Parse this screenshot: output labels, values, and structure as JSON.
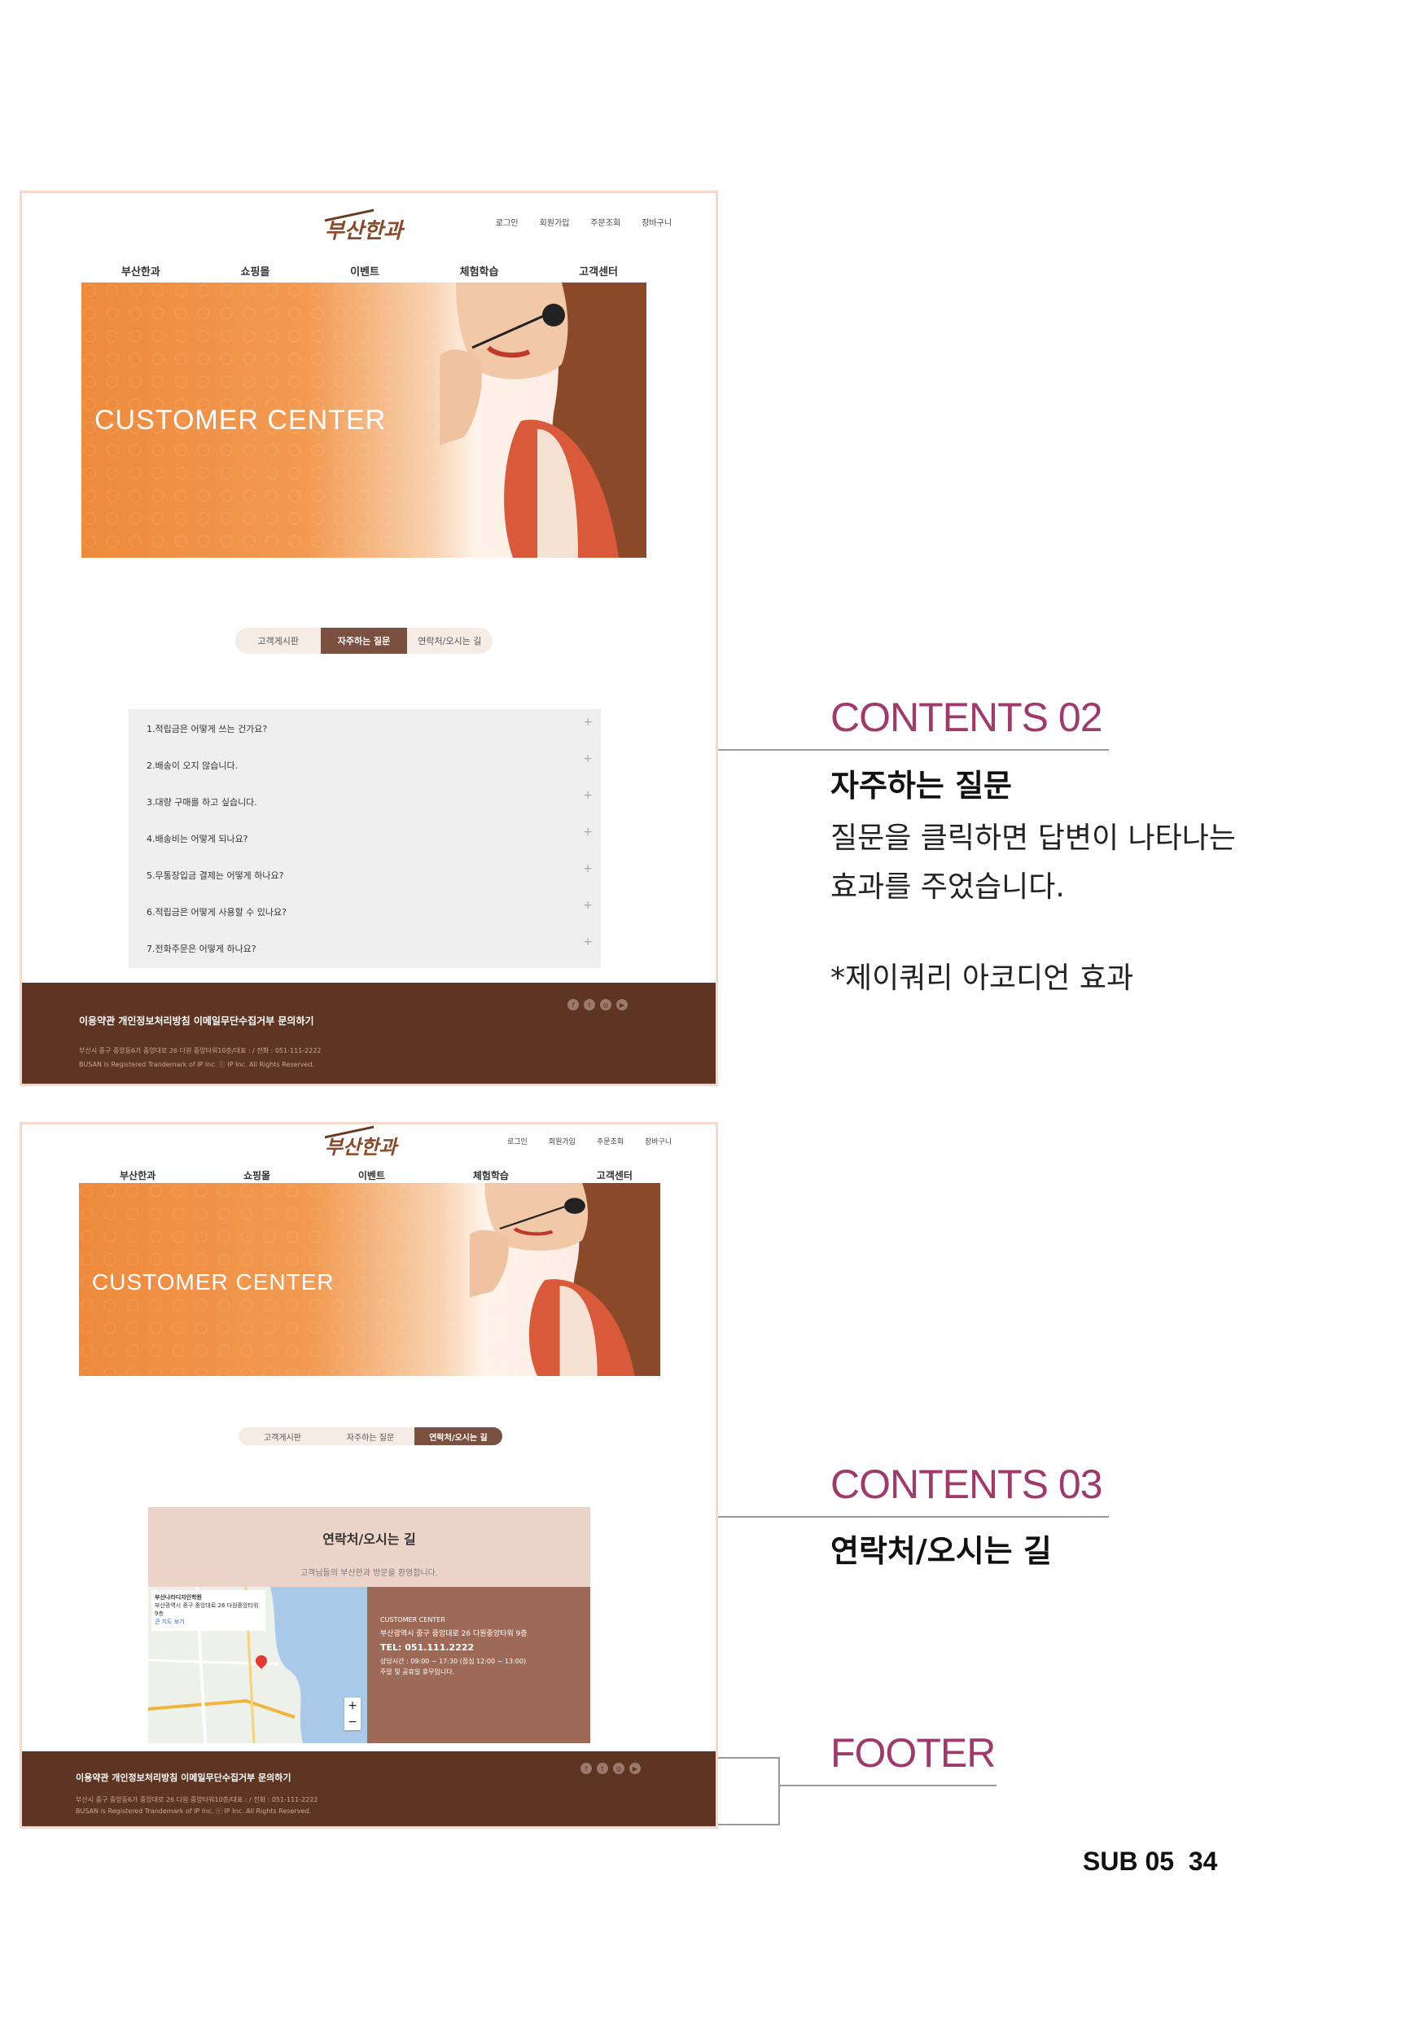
{
  "mockup1": {
    "logo": "부산한과",
    "util_menu": [
      "로그인",
      "회원가입",
      "주문조회",
      "장바구니"
    ],
    "gnb": [
      "부산한과",
      "쇼핑몰",
      "이벤트",
      "체험학습",
      "고객센터"
    ],
    "hero_title": "CUSTOMER CENTER",
    "tabs": [
      "고객게시판",
      "자주하는 질문",
      "연락처/오시는 길"
    ],
    "active_tab": 1,
    "faq": [
      "1.적립금은 어떻게 쓰는 건가요?",
      "2.배송이 오지 않습니다.",
      "3.대량 구매를 하고 싶습니다.",
      "4.배송비는 어떻게 되나요?",
      "5.무통장입금 결제는 어떻게 하나요?",
      "6.적립금은 어떻게 사용할 수 있나요?",
      "7.전화주문은 어떻게 하나요?"
    ],
    "footer_links": "이용약관  개인정보처리방침  이메일무단수집거부  문의하기",
    "footer_address": "부산시 중구 중앙동6가 중앙대로 26 다원 중앙타워10층/대표 : / 전화 : 051-111-2222",
    "footer_copyright": "BUSAN is Registered Trandemark of IP Inc. ⓒ IP Inc. All Rights Reserved."
  },
  "mockup2": {
    "logo": "부산한과",
    "util_menu": [
      "로그인",
      "회원가입",
      "주문조회",
      "장바구니"
    ],
    "gnb": [
      "부산한과",
      "쇼핑몰",
      "이벤트",
      "체험학습",
      "고객센터"
    ],
    "hero_title": "CUSTOMER CENTER",
    "tabs": [
      "고객게시판",
      "자주하는 질문",
      "연락처/오시는 길"
    ],
    "active_tab": 2,
    "contact_title": "연락처/오시는 길",
    "contact_welcome": "고객님들의 부산한과 방문을 환영합니다.",
    "map_place": "부산나라디자인학원",
    "map_addr": "부산광역시 중구 중앙대로 26 다원중앙타워 9층",
    "map_link": "큰 지도 보기",
    "info_label": "CUSTOMER CENTER",
    "info_address": "부산광역시 중구 중앙대로 26 다원중앙타워 9층",
    "info_tel": "TEL: 051.111.2222",
    "info_hours": "상담시간 : 09:00 ~ 17:30 (점심 12:00 ~ 13:00)",
    "info_holiday": "주말 및 공휴일 휴무입니다.",
    "footer_links": "이용약관  개인정보처리방침  이메일무단수집거부  문의하기",
    "footer_address": "부산시 중구 중앙동6가 중앙대로 26 다원 중앙타워10층/대표 : / 전화 : 051-111-2222",
    "footer_copyright": "BUSAN is Registered Trandemark of IP Inc. ⓒ IP Inc. All Rights Reserved."
  },
  "annotations": {
    "c02_title": "CONTENTS 02",
    "c02_sub": "자주하는 질문",
    "c02_desc1": "질문을 클릭하면 답변이 나타나는",
    "c02_desc2": "효과를 주었습니다.",
    "c02_note": "*제이쿼리 아코디언 효과",
    "c03_title": "CONTENTS 03",
    "c03_sub": "연락처/오시는 길",
    "footer_title": "FOOTER"
  },
  "page_label": "SUB 05",
  "page_number": "34",
  "colors": {
    "accent": "#a03a6c",
    "footer": "#5e3422",
    "hero": "#ee8a3c",
    "tab_active": "#7a5040"
  }
}
